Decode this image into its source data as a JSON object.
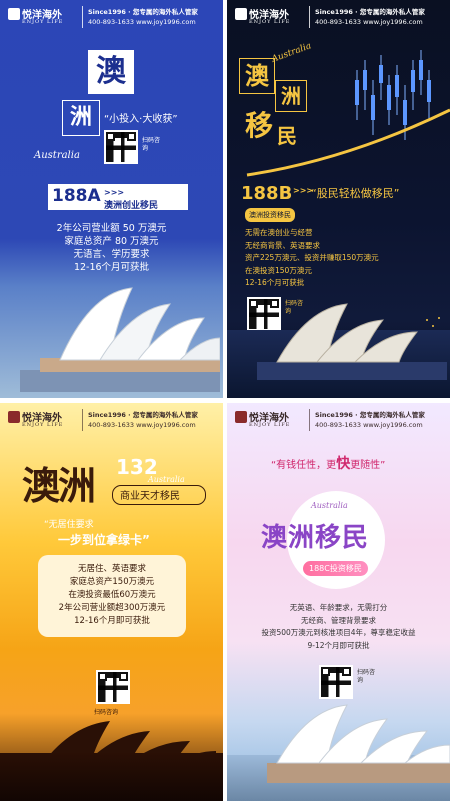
{
  "header": {
    "brand": "悦洋海外",
    "brand_sub": "ENJOY LIFE",
    "tagline": "Since1996 · 您专属的海外私人管家",
    "contact": "400-893-1633   www.joy1996.com"
  },
  "qr_label": "扫码咨询",
  "panels": [
    {
      "title_ao": "澳",
      "title_zhou": "洲",
      "script": "Australia",
      "slogan": "“小投入·大收获”",
      "code": "188A",
      "arrows": ">>>",
      "program": "澳洲创业移民",
      "requirements": [
        "2年公司营业额 50 万澳元",
        "家庭总资产 80 万澳元",
        "无语言、学历要求",
        "12-16个月可获批"
      ]
    },
    {
      "title_ao": "澳",
      "title_zhou": "洲",
      "title_yi": "移",
      "title_min": "民",
      "script": "Australia",
      "code": "188B",
      "arrows": ">>>",
      "slogan": "“股民轻松做移民”",
      "tag": "澳洲投资移民",
      "requirements": [
        "无需在澳创业与经营",
        "无经商背景、英语要求",
        "资产225万澳元、投资并赚取150万澳元",
        "在澳投资150万澳元",
        "12-16个月可获批"
      ]
    },
    {
      "title": "澳洲",
      "code": "132",
      "script": "Australia",
      "program": "商业天才移民",
      "slogan_line1": "“无居住要求",
      "slogan_line2": "一步到位拿绿卡”",
      "requirements": [
        "无居住、英语要求",
        "家庭总资产150万澳元",
        "在澳投资最低60万澳元",
        "2年公司营业额超300万澳元",
        "12-16个月即可获批"
      ]
    },
    {
      "slogan_a": "“有钱任性，更",
      "slogan_em": "快",
      "slogan_b": "更随性”",
      "script": "Australia",
      "title": "澳洲移民",
      "tag": "188C投资移民",
      "requirements": [
        "无英语、年龄要求，无需打分",
        "无经商、管理背景要求",
        "投资500万澳元到核准项目4年，尊享稳定收益",
        "9-12个月即可获批"
      ]
    }
  ]
}
